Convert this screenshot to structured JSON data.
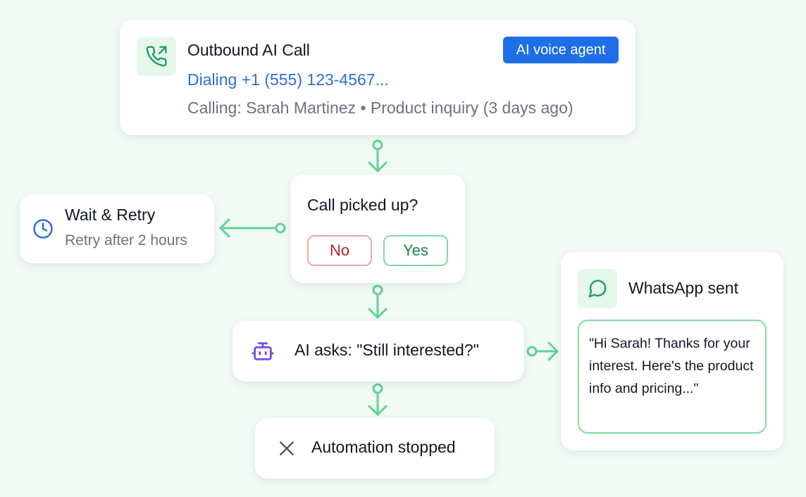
{
  "outbound_call": {
    "title": "Outbound AI Call",
    "badge": "AI voice agent",
    "status": "Dialing +1 (555) 123-4567...",
    "details": "Calling: Sarah Martinez • Product inquiry (3 days ago)",
    "icon": "phone-outgoing-icon"
  },
  "decision": {
    "question": "Call picked up?",
    "no_label": "No",
    "yes_label": "Yes"
  },
  "retry": {
    "title": "Wait & Retry",
    "subtitle": "Retry after 2 hours",
    "icon": "clock-icon"
  },
  "ai_ask": {
    "text": "AI asks: \"Still interested?\"",
    "icon": "robot-icon"
  },
  "stopped": {
    "text": "Automation stopped",
    "icon": "close-icon"
  },
  "whatsapp": {
    "title": "WhatsApp sent",
    "message": "\"Hi Sarah! Thanks for your interest. Here's the product info and pricing...\"",
    "icon": "chat-bubble-icon"
  },
  "colors": {
    "background": "#f1faf4",
    "connector": "#5fd394",
    "badge": "#1e6ee8",
    "link_text": "#2f6fd6",
    "no_border": "#f2a6aa",
    "yes_border": "#7fdca2"
  }
}
